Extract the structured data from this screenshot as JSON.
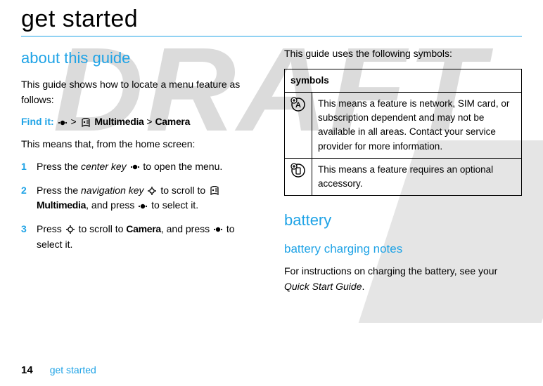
{
  "watermark": "DRAFT",
  "title": "get started",
  "left": {
    "heading": "about this guide",
    "intro": "This guide shows how to locate a menu feature as follows:",
    "find_it": {
      "label": "Find it: ",
      "sep": " > ",
      "multimedia": "Multimedia",
      "camera": "Camera"
    },
    "means": "This means that, from the home screen:",
    "steps": [
      {
        "num": "1",
        "t1": "Press the ",
        "it": "center key",
        "t2": " to open the menu."
      },
      {
        "num": "2",
        "t1": "Press the ",
        "it": "navigation key",
        "t2": " to scroll to ",
        "mm": "Multimedia",
        "t3": ", and press ",
        "t4": " to select it."
      },
      {
        "num": "3",
        "t1": "Press ",
        "t2": " to scroll to ",
        "cam": "Camera",
        "t3": ", and press ",
        "t4": " to select it."
      }
    ]
  },
  "right": {
    "symbols_intro": "This guide uses the following symbols:",
    "table": {
      "header": "symbols",
      "rows": [
        {
          "desc": "This means a feature is network, SIM card, or subscription dependent and may not be available in all areas. Contact your service provider for more information."
        },
        {
          "desc": "This means a feature requires an optional accessory."
        }
      ]
    },
    "battery": {
      "heading": "battery",
      "sub": "battery charging notes",
      "body1": "For instructions on charging the battery, see your ",
      "ital": "Quick Start Guide",
      "body2": "."
    }
  },
  "footer": {
    "page": "14",
    "section": "get started"
  }
}
